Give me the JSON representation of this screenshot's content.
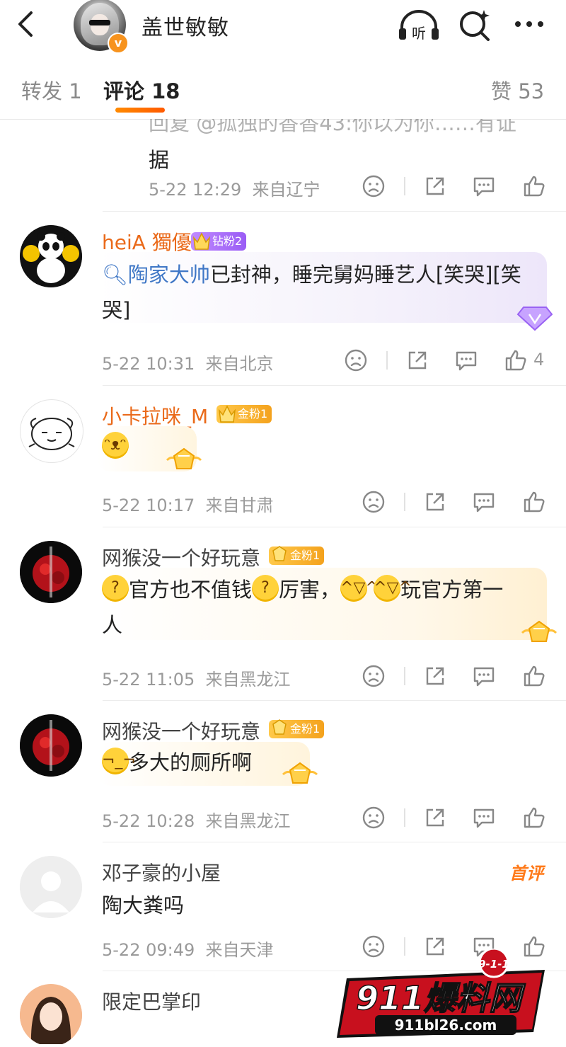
{
  "header": {
    "user_name": "盖世敏敏",
    "listen_label": "听"
  },
  "tabs": [
    {
      "label": "转发 1"
    },
    {
      "label": "评论 18"
    },
    {
      "label": "赞 53"
    }
  ],
  "comments": [
    {
      "clipped_text_line1": "回复 @孤独的香香43:你以为你……有证",
      "clipped_text_line2": "据",
      "time": "5-22 12:29",
      "location": "来自辽宁",
      "likes": ""
    },
    {
      "user": "heiA 獨優",
      "badge": "钻粉2",
      "link": "陶家大帅",
      "text_after_link": "已封神，睡完舅妈睡艺人[笑哭][笑",
      "text_line2": "哭]",
      "time": "5-22 10:31",
      "location": "来自北京",
      "likes": "4"
    },
    {
      "user": "小卡拉咪_M",
      "badge": "金粉1",
      "time": "5-22 10:17",
      "location": "来自甘肃",
      "likes": ""
    },
    {
      "user": "网猴没一个好玩意",
      "badge": "金粉1",
      "text_a": "官方也不值钱",
      "text_b": "厉害，",
      "text_c": "玩官方第一",
      "text_line2": "人",
      "time": "5-22 11:05",
      "location": "来自黑龙江",
      "likes": ""
    },
    {
      "user": "网猴没一个好玩意",
      "badge": "金粉1",
      "text": "多大的厕所啊",
      "time": "5-22 10:28",
      "location": "来自黑龙江",
      "likes": ""
    },
    {
      "user": "邓子豪的小屋",
      "tag": "首评",
      "text": "陶大粪吗",
      "time": "5-22 09:49",
      "location": "来自天津",
      "likes": ""
    },
    {
      "user": "限定巴掌印"
    }
  ],
  "watermark": {
    "badge": "9-1-1",
    "brand": "911爆料网",
    "url": "911bl26.com"
  },
  "colors": {
    "accent": "#ff6a00",
    "username_orange": "#ea6a1a",
    "link_blue": "#3f77c6",
    "meta_gray": "#9a9a9a"
  }
}
